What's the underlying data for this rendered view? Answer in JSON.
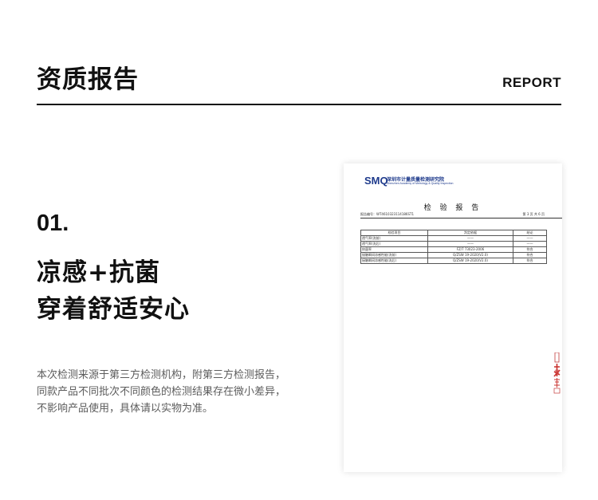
{
  "header": {
    "title": "资质报告",
    "tag": "REPORT"
  },
  "section": {
    "number": "01.",
    "headline": [
      "凉感+抗菌",
      "穿着舒适安心"
    ],
    "note": [
      "本次检测来源于第三方检测机构，附第三方检测报告，",
      "同款产品不同批次不同颜色的检测结果存在微小差异，",
      "不影响产品使用，具体请以实物为准。"
    ]
  },
  "document": {
    "logo": "SMQ",
    "org_name": "深圳市计量质量检测研究院",
    "org_name_en": "Shenzhen Academy of Metrology & Quality Inspection",
    "title": "检 验 报 告",
    "report_no": "报告编号：WT4610323114186ST1",
    "page_info": "第 3 页 共 6 页",
    "table_headers": [
      "检验项目",
      "判定依据",
      "结论"
    ],
    "table_rows": [
      [
        "透气率(洗前)",
        "——",
        "——"
      ],
      [
        "透气率(洗后)",
        "——",
        "——"
      ],
      [
        "抑菌率",
        "FZ/T 73023-2006",
        "符合"
      ],
      [
        "接触瞬间凉感性能(洗前)",
        "Q/ZSW 19-2020(V2.0)",
        "符合"
      ],
      [
        "接触瞬间凉感性能(洗后)",
        "Q/ZSW 19-2020(V2.0)",
        "符合"
      ]
    ]
  }
}
